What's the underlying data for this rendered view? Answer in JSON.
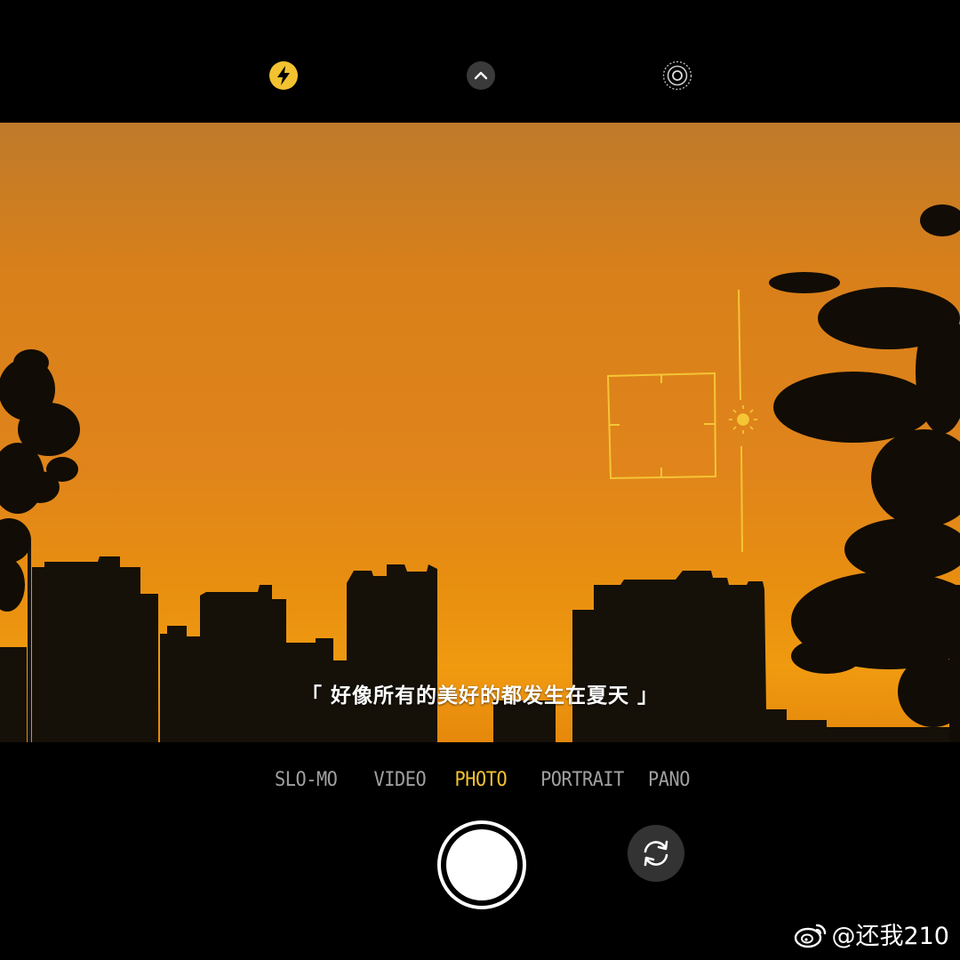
{
  "top_bar": {
    "flash_icon": "flash-icon",
    "more_icon": "chevron-up-icon",
    "live_icon": "live-photo-icon",
    "flash_color": "#f2c230"
  },
  "viewfinder": {
    "caption": "「 好像所有的美好的都发生在夏天 」",
    "focus_color": "#f2c230",
    "exposure_icon": "sun-icon"
  },
  "modes": [
    "SLO-MO",
    "VIDEO",
    "PHOTO",
    "PORTRAIT",
    "PANO"
  ],
  "active_mode": "PHOTO",
  "controls": {
    "shutter_icon": "shutter-button",
    "flip_icon": "camera-flip-icon"
  },
  "watermark": {
    "icon": "weibo-icon",
    "text": "@还我210"
  }
}
